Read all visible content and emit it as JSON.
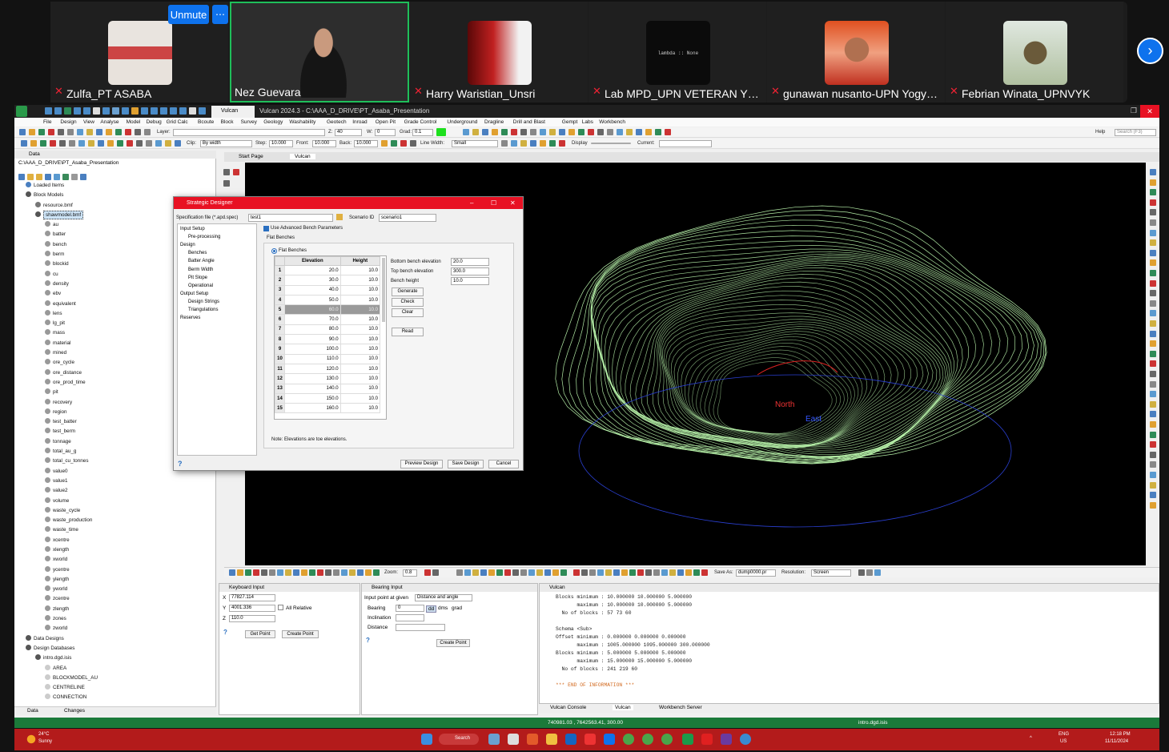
{
  "meeting": {
    "unmute_label": "Unmute",
    "more_label": "⋯",
    "participants": [
      {
        "name": "Zulfa_PT ASABA"
      },
      {
        "name": "Nez Guevara"
      },
      {
        "name": "Harry Waristian_Unsri"
      },
      {
        "name": "Lab MPD_UPN VETERAN YOGYA..."
      },
      {
        "name": "gunawan nusanto-UPN Yogyakar..."
      },
      {
        "name": "Febrian Winata_UPNVYK"
      }
    ],
    "lambda_text": "lambda :: None"
  },
  "app": {
    "title": "Vulcan 2024.3 - C:\\AAA_D_DRIVE\\PT_Asaba_Presentation",
    "tab_label": "Vulcan",
    "menu": [
      "File",
      "Design",
      "View",
      "Analyse",
      "Model",
      "Debug",
      "Grid Calc",
      "Bcoute",
      "Block",
      "Survey",
      "Geology",
      "Washability",
      "Geotech",
      "Inroad",
      "Open Pit",
      "Grade Control",
      "Underground",
      "Dragline",
      "Drill and Blast",
      "Gempt",
      "Labs",
      "Workbench"
    ],
    "help_label": "Help",
    "search_placeholder": "Search (F3)",
    "toolbar2": {
      "layer_label": "Layer:",
      "z_label": "Z:",
      "z_value": "40",
      "w_label": "W:",
      "w_value": "0",
      "grad_label": "Grad:",
      "grad_value": "0.1"
    },
    "toolbar3": {
      "clip_label": "Clip:",
      "clip_value": "By width",
      "step_label": "Step:",
      "step_value": "10.000",
      "front_label": "Front:",
      "front_value": "10.000",
      "back_label": "Back:",
      "back_value": "10.000",
      "linewidth_label": "Line Width:",
      "linewidth_value": "Small",
      "display_label": "Display",
      "current_label": "Current:"
    }
  },
  "data_panel": {
    "header": "Data",
    "path": "C:\\AAA_D_DRIVE\\PT_Asaba_Presentation",
    "loaded_items": "Loaded Items",
    "block_models": "Block Models",
    "resource": "resource.bmf",
    "selected_model": "shawmodel.bmf",
    "variables": [
      "au",
      "batter",
      "bench",
      "berm",
      "blockid",
      "cu",
      "density",
      "ebv",
      "equivalent",
      "lens",
      "lg_pit",
      "mass",
      "material",
      "mined",
      "ore_cycle",
      "ore_distance",
      "ore_prod_time",
      "pit",
      "recovery",
      "region",
      "test_batter",
      "test_berm",
      "tonnage",
      "total_au_g",
      "total_cu_tonnes",
      "value0",
      "value1",
      "value2",
      "volume",
      "waste_cycle",
      "waste_production",
      "waste_time",
      "xcentre",
      "xlength",
      "xworld",
      "ycentre",
      "ylength",
      "yworld",
      "zcentre",
      "zlength",
      "zones",
      "zworld"
    ],
    "data_designs": "Data Designs",
    "design_databases": "Design Databases",
    "db_name": "intro.dgd.isis",
    "db_layers": [
      "AREA",
      "BLOCKMODEL_AU",
      "CENTRELINE",
      "CONNECTION"
    ],
    "tabs": [
      "Data",
      "Changes"
    ]
  },
  "doc_tabs": [
    "Start Page",
    "Vulcan"
  ],
  "viewport": {
    "label_north": "North",
    "label_east": "East",
    "bottom": {
      "zoom_label": "Zoom:",
      "zoom_value": "0.8",
      "save_as_label": "Save As:",
      "save_as_value": "dump0000.pr",
      "resolution_label": "Resolution:",
      "resolution_value": "Screen"
    }
  },
  "dialog": {
    "title": "Strategic Designer",
    "spec_label": "Specification file (*.apd.spec)",
    "spec_value": "test1",
    "scenario_label": "Scenario ID",
    "scenario_value": "scenario1",
    "nav": [
      {
        "label": "Input Setup",
        "indent": 0
      },
      {
        "label": "Pre-processing",
        "indent": 1
      },
      {
        "label": "Design",
        "indent": 0
      },
      {
        "label": "Benches",
        "indent": 1
      },
      {
        "label": "Batter Angle",
        "indent": 1
      },
      {
        "label": "Berm Width",
        "indent": 1
      },
      {
        "label": "Pit Slope",
        "indent": 1
      },
      {
        "label": "Operational",
        "indent": 1
      },
      {
        "label": "Output Setup",
        "indent": 0
      },
      {
        "label": "Design Strings",
        "indent": 1
      },
      {
        "label": "Triangulations",
        "indent": 1
      },
      {
        "label": "Reserves",
        "indent": 0
      }
    ],
    "use_advanced": "Use Advanced Bench Parameters",
    "flat_benches_tab": "Flat Benches",
    "flat_benches_radio": "Flat Benches",
    "col_elevation": "Elevation",
    "col_height": "Height",
    "rows": [
      {
        "n": "1",
        "elev": "20.0",
        "h": "10.0"
      },
      {
        "n": "2",
        "elev": "30.0",
        "h": "10.0"
      },
      {
        "n": "3",
        "elev": "40.0",
        "h": "10.0"
      },
      {
        "n": "4",
        "elev": "50.0",
        "h": "10.0"
      },
      {
        "n": "5",
        "elev": "60.0",
        "h": "10.0"
      },
      {
        "n": "6",
        "elev": "70.0",
        "h": "10.0"
      },
      {
        "n": "7",
        "elev": "80.0",
        "h": "10.0"
      },
      {
        "n": "8",
        "elev": "90.0",
        "h": "10.0"
      },
      {
        "n": "9",
        "elev": "100.0",
        "h": "10.0"
      },
      {
        "n": "10",
        "elev": "110.0",
        "h": "10.0"
      },
      {
        "n": "11",
        "elev": "120.0",
        "h": "10.0"
      },
      {
        "n": "12",
        "elev": "130.0",
        "h": "10.0"
      },
      {
        "n": "13",
        "elev": "140.0",
        "h": "10.0"
      },
      {
        "n": "14",
        "elev": "150.0",
        "h": "10.0"
      },
      {
        "n": "15",
        "elev": "160.0",
        "h": "10.0"
      }
    ],
    "selected_row": 5,
    "bottom_bench_label": "Bottom bench elevation",
    "bottom_bench_value": "20.0",
    "top_bench_label": "Top bench elevation",
    "top_bench_value": "300.0",
    "bench_height_label": "Bench height",
    "bench_height_value": "10.0",
    "btn_generate": "Generate",
    "btn_check": "Check",
    "btn_clear": "Clear",
    "btn_read": "Read",
    "note": "Note: Elevations are toe elevations.",
    "btn_preview": "Preview Design",
    "btn_save": "Save Design",
    "btn_cancel": "Cancel"
  },
  "keyboard_input": {
    "title": "Keyboard Input",
    "x_label": "X",
    "x_value": "77827.114",
    "y_label": "Y",
    "y_value": "4001.336",
    "z_label": "Z",
    "z_value": "110.0",
    "all_relative": "All Relative",
    "get_point": "Get Point",
    "create_point": "Create Point"
  },
  "bearing_input": {
    "title": "Bearing Input",
    "input_label": "Input point at given",
    "input_value": "Distance and angle",
    "bearing_label": "Bearing",
    "bearing_value": "0",
    "units": [
      "dd",
      "dms",
      "grad"
    ],
    "inclination_label": "Inclination",
    "distance_label": "Distance",
    "create_point": "Create Point"
  },
  "console": {
    "title": "Vulcan",
    "lines": [
      "Blocks minimum : 10.000000 10.000000 5.000000",
      "       maximum : 10.000000 10.000000 5.000000",
      "  No of blocks : 57 73 60",
      "",
      "Schema <Sub>",
      "Offset minimum : 0.000000 0.000000 0.000000",
      "       maximum : 1005.000000 1095.000000 300.000000",
      "Blocks minimum : 5.000000 5.000000 5.000000",
      "       maximum : 15.000000 15.000000 5.000000",
      "  No of blocks : 241 219 60",
      "",
      "*** END OF INFORMATION ***"
    ],
    "tabs": [
      "Vulcan Console",
      "Vulcan",
      "Workbench Server"
    ]
  },
  "status": {
    "coords": "740981.03 , 7642563.41, 300.00",
    "db": "intro.dgd.isis"
  },
  "taskbar": {
    "weather_temp": "24°C",
    "weather_desc": "Sunny",
    "search_label": "Search",
    "lang": "ENG",
    "region": "US",
    "time": "12:18 PM",
    "date": "11/11/2024"
  },
  "colors": {
    "accent_green": "#1b7a3a",
    "dialog_red": "#e81123",
    "zoom_blue": "#0e72ed",
    "contour": "#b6f0a8",
    "taskbar": "#b31b1b"
  }
}
